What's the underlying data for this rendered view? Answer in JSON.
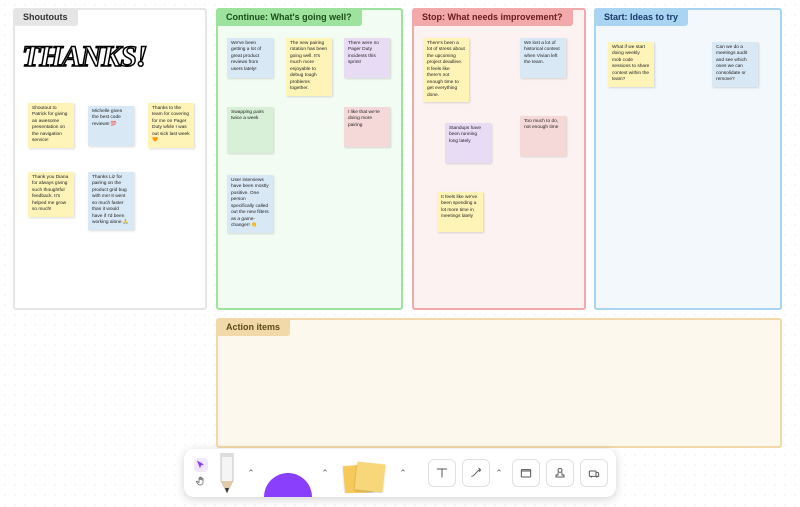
{
  "columns": {
    "shoutouts": {
      "title": "Shoutouts"
    },
    "continue": {
      "title": "Continue: What's going well?"
    },
    "stop": {
      "title": "Stop: What needs improvement?"
    },
    "ideas": {
      "title": "Start: Ideas to try"
    },
    "actions": {
      "title": "Action items"
    }
  },
  "hero_text": "THANKS!",
  "stickies": {
    "s1": "Shoutout to Patrick for giving an awesome presentation on the navigation service!",
    "s2": "Michelle gives the best code reviews! 💯",
    "s3": "Thanks to the team for covering for me on Pager Duty while I was out sick last week 🧡",
    "s4": "Thank you Diana for always giving such thoughtful feedback. It's helped me grow so much!",
    "s5": "Thanks Liz for pairing on the product grid bug with me! It went so much faster than it would have if I'd been working alone 🙏",
    "c1": "We've been getting a lot of great product reviews from users lately!",
    "c2": "The new pairing rotation has been going well. It's much more enjoyable to debug tough problems together.",
    "c3": "There were no Pager Duty incidents this sprint!",
    "c4": "Swapping pairs twice a week",
    "c5": "I like that we're doing more pairing",
    "c6": "User interviews have been mostly positive. One person specifically called out the new filters as a game-changer! 👏",
    "p1": "There's been a lot of stress about the upcoming project deadline. It feels like there's not enough time to get everything done.",
    "p2": "We lost a lot of historical context when Vivian left the team.",
    "p3": "Standups have been running long lately",
    "p4": "Too much to do, not enough time",
    "p5": "It feels like we've been spending a lot more time in meetings lately",
    "i1": "What if we start doing weekly mob code sessions to share context within the team?",
    "i2": "Can we do a meetings audit and see which ones we can consolidate or remove?"
  },
  "toolbar": {
    "cursor": "cursor-tool",
    "hand": "pan-tool",
    "pencil": "draw-tool",
    "shape": "shape-tool",
    "sticky": "sticky-tool",
    "text": "text-tool",
    "connector": "connector-tool",
    "frame": "frame-tool",
    "stamp": "stamp-tool",
    "more": "more-tools"
  }
}
